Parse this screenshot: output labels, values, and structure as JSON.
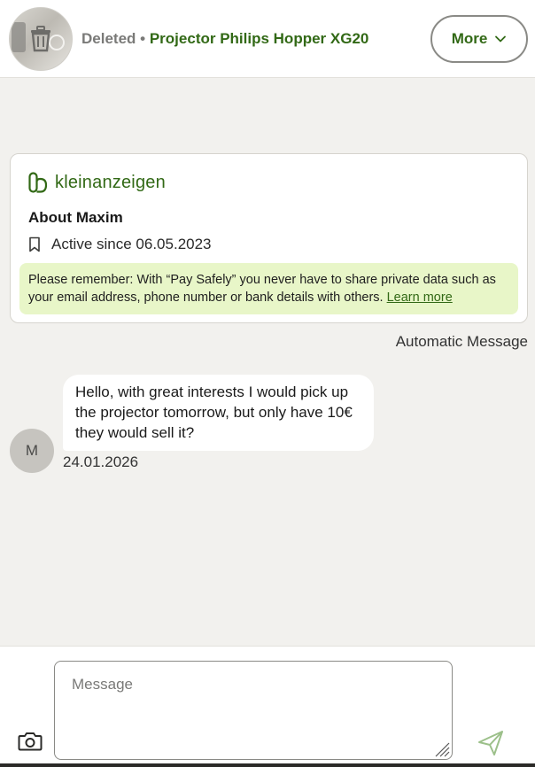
{
  "header": {
    "status": "Deleted",
    "separator": "•",
    "ad_title": "Projector Philips Hopper XG20",
    "more_label": "More"
  },
  "info_card": {
    "brand": "kleinanzeigen",
    "about": "About Maxim",
    "active_since": "Active since 06.05.2023",
    "notice_text": "Please remember: With “Pay Safely” you never have to share private data such as your email address, phone number or bank details with others. ",
    "learn_more": "Learn more"
  },
  "automatic_message": "Automatic Message",
  "message": {
    "avatar_initial": "M",
    "text": "Hello, with great interests I would pick up the projector tomorrow, but only have 10€ they would sell it?",
    "date": "24.01.2026"
  },
  "composer": {
    "placeholder": "Message"
  },
  "colors": {
    "brand_green": "#326916",
    "notice_bg": "#e8f6c8",
    "page_bg": "#f2f1ee"
  },
  "icons": [
    "trash-icon",
    "chevron-down-icon",
    "kleinanzeigen-logo-icon",
    "bookmark-icon",
    "camera-icon",
    "send-icon"
  ]
}
